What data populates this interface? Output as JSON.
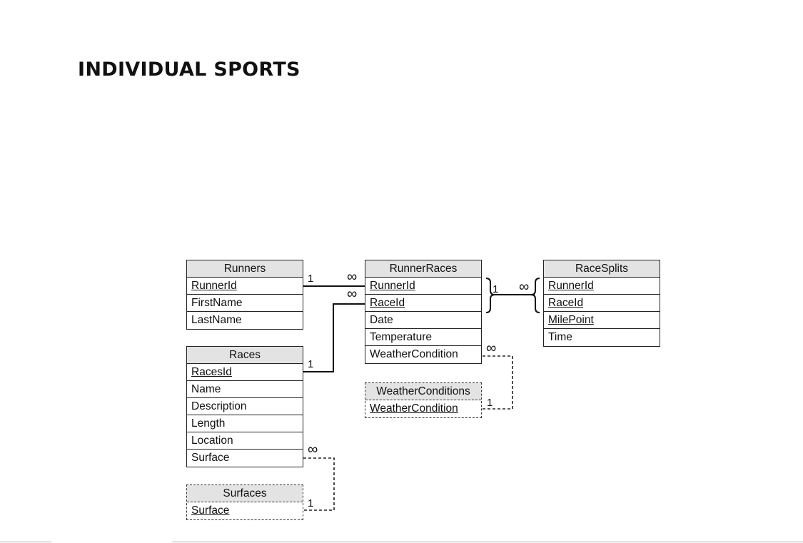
{
  "title": "INDIVIDUAL SPORTS",
  "tables": {
    "runners": {
      "name": "Runners",
      "fields": [
        "RunnerId",
        "FirstName",
        "LastName"
      ]
    },
    "runner_races": {
      "name": "RunnerRaces",
      "fields": [
        "RunnerId",
        "RaceId",
        "Date",
        "Temperature",
        "WeatherCondition"
      ]
    },
    "race_splits": {
      "name": "RaceSplits",
      "fields": [
        "RunnerId",
        "RaceId",
        "MilePoint",
        "Time"
      ]
    },
    "races": {
      "name": "Races",
      "fields": [
        "RacesId",
        "Name",
        "Description",
        "Length",
        "Location",
        "Surface"
      ]
    },
    "weather_conditions": {
      "name": "WeatherConditions",
      "fields": [
        "WeatherCondition"
      ]
    },
    "surfaces": {
      "name": "Surfaces",
      "fields": [
        "Surface"
      ]
    }
  },
  "cardinality": {
    "one": "1",
    "many": "∞"
  }
}
